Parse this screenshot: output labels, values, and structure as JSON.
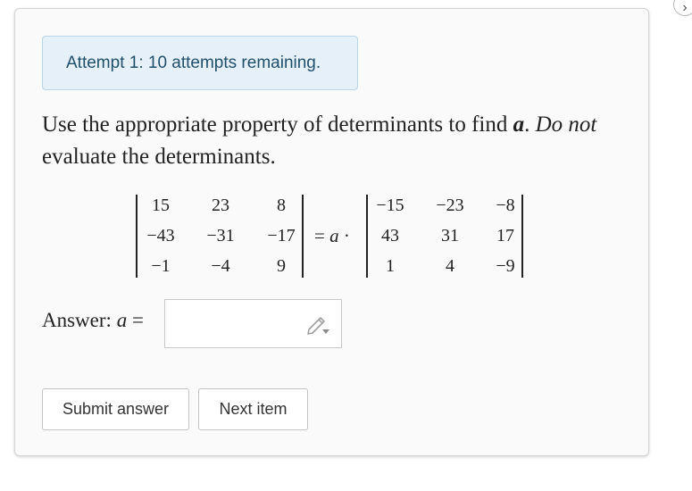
{
  "status": {
    "attempt_message": "Attempt 1: 10 attempts remaining."
  },
  "question": {
    "text_before": "Use the appropriate property of determinants to find ",
    "variable": "a",
    "text_period": ". ",
    "emphasis": "Do not",
    "text_after": " evaluate the determinants."
  },
  "equation": {
    "left_matrix": [
      [
        "15",
        "23",
        "8"
      ],
      [
        "−43",
        "−31",
        "−17"
      ],
      [
        "−1",
        "−4",
        "9"
      ]
    ],
    "equals_sign": "=",
    "scalar": "a",
    "dot": "·",
    "right_matrix": [
      [
        "−15",
        "−23",
        "−8"
      ],
      [
        "43",
        "31",
        "17"
      ],
      [
        "1",
        "4",
        "−9"
      ]
    ]
  },
  "answer": {
    "label": "Answer:",
    "variable": "a",
    "equals_sign": "=",
    "value": ""
  },
  "buttons": {
    "submit_label": "Submit answer",
    "next_label": "Next item"
  },
  "icons": {
    "edit": "pencil-icon",
    "dropdown": "caret-down-icon",
    "corner": "chevron-right-icon"
  },
  "colors": {
    "alert_background": "#e6f0f8",
    "alert_border": "#b9d7e8",
    "alert_text": "#1f4f6b",
    "card_background": "#fafafa"
  }
}
